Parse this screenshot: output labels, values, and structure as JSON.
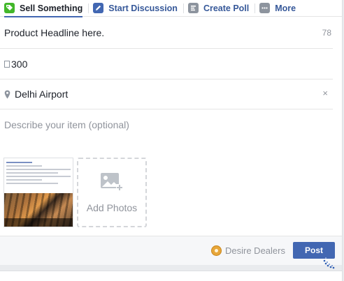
{
  "tabs": [
    {
      "label": "Sell Something",
      "icon": "sell-tag-icon",
      "active": true
    },
    {
      "label": "Start Discussion",
      "icon": "pencil-icon",
      "active": false
    },
    {
      "label": "Create Poll",
      "icon": "poll-icon",
      "active": false
    },
    {
      "label": "More",
      "icon": "more-dots-icon",
      "active": false
    }
  ],
  "form": {
    "headline_value": "Product Headline here.",
    "headline_counter": "78",
    "price_value": "300",
    "location_value": "Delhi Airport",
    "location_clear_label": "×",
    "description_placeholder": "Describe your item (optional)"
  },
  "attachments": {
    "add_photos_label": "Add Photos"
  },
  "footer": {
    "page_name": "Desire Dealers",
    "post_label": "Post"
  },
  "colors": {
    "accent": "#4267b2",
    "link": "#365899",
    "placeholder": "#90949c",
    "sell_icon": "#42b72a"
  }
}
